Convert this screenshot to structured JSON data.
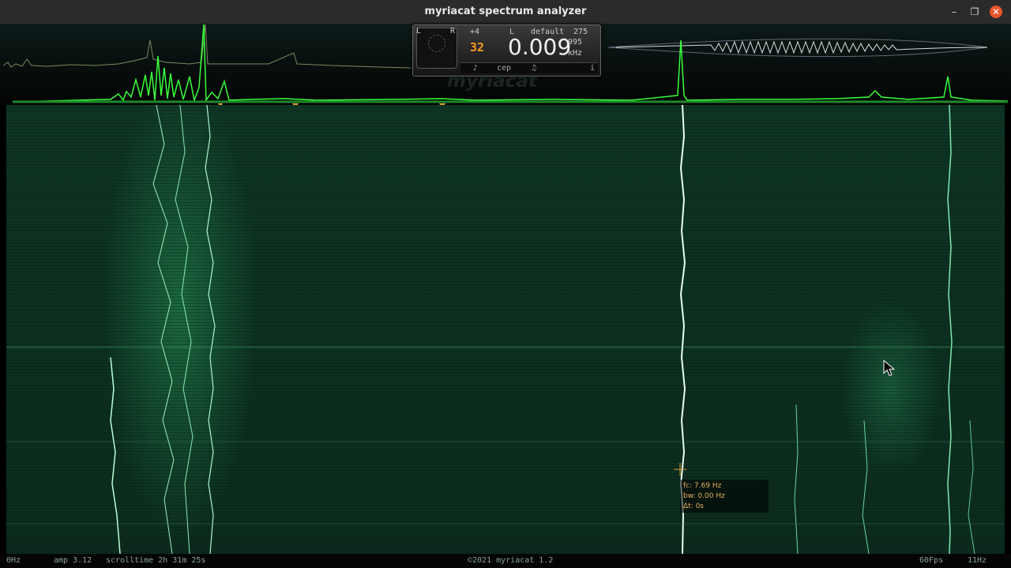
{
  "window": {
    "title": "myriacat spectrum analyzer",
    "controls": {
      "minimize": "–",
      "maximize": "❐",
      "close": "✕"
    }
  },
  "panel": {
    "scope_l": "L",
    "scope_r": "R",
    "transpose": "+4",
    "channel": "L",
    "preset": "default",
    "preset_num": "275",
    "octave": "32",
    "frequency": "0.009",
    "sub_value": "995",
    "unit": "kHz",
    "buttons": {
      "fork": "♪",
      "cep": "cep",
      "note": "♫",
      "info": "i"
    }
  },
  "watermark": "myriacat",
  "cursor_readout": {
    "fc": "fc: 7.69 Hz",
    "bw": "bw: 0.00 Hz",
    "dt": "Δt: 0s"
  },
  "status": {
    "low_freq": "0Hz",
    "amp": "amp 3.12",
    "scrolltime": "scrolltime 2h 31m 25s",
    "copyright": "©2021 myriacat 1.2",
    "fps": "60Fps",
    "high_freq": "11Hz"
  },
  "colors": {
    "spectrum_green": "#39ff3a",
    "trace_green": "#9cffc8",
    "waterfall_bg": "#0d3020",
    "marker_orange": "#d9a030",
    "close_red": "#e9542b"
  }
}
